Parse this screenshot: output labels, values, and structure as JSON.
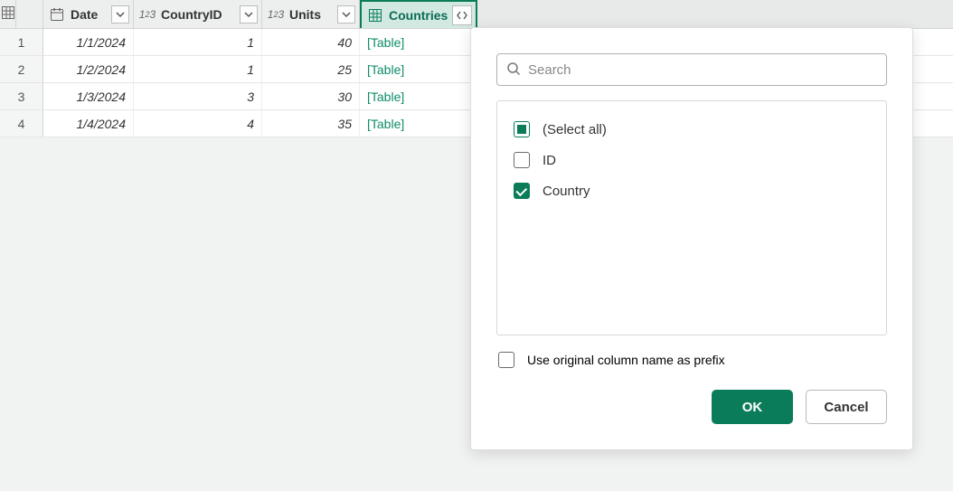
{
  "columns": {
    "date": {
      "label": "Date"
    },
    "countryid": {
      "label": "CountryID"
    },
    "units": {
      "label": "Units"
    },
    "countries": {
      "label": "Countries"
    }
  },
  "rows": [
    {
      "num": "1",
      "date": "1/1/2024",
      "countryid": "1",
      "units": "40",
      "countries": "[Table]"
    },
    {
      "num": "2",
      "date": "1/2/2024",
      "countryid": "1",
      "units": "25",
      "countries": "[Table]"
    },
    {
      "num": "3",
      "date": "1/3/2024",
      "countryid": "3",
      "units": "30",
      "countries": "[Table]"
    },
    {
      "num": "4",
      "date": "1/4/2024",
      "countryid": "4",
      "units": "35",
      "countries": "[Table]"
    }
  ],
  "flyout": {
    "search_placeholder": "Search",
    "options": [
      {
        "label": "(Select all)",
        "state": "indeterminate"
      },
      {
        "label": "ID",
        "state": "unchecked"
      },
      {
        "label": "Country",
        "state": "checked"
      }
    ],
    "prefix_label": "Use original column name as prefix",
    "ok": "OK",
    "cancel": "Cancel"
  }
}
